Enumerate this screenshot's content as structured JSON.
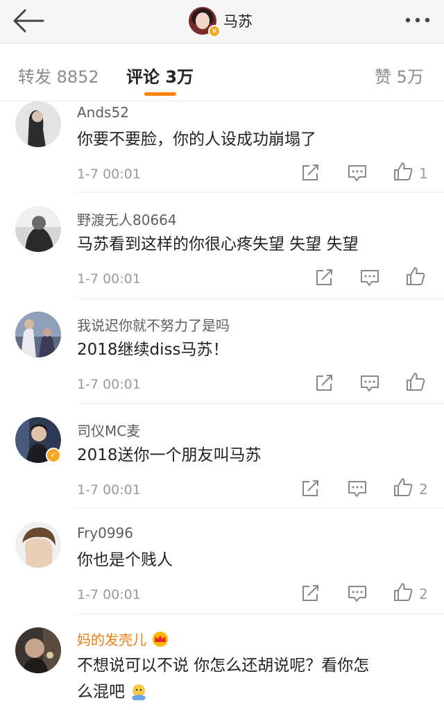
{
  "header": {
    "title": "马苏",
    "badge": "v",
    "back_icon": "back-arrow-icon",
    "more_icon": "more-dots-icon"
  },
  "tabs": {
    "repost": "转发 8852",
    "comment": "评论 3万",
    "like": "赞 5万"
  },
  "colors": {
    "accent": "#ff8200",
    "vip_name": "#f07b12",
    "badge": "#f5a623"
  },
  "comments": [
    {
      "name": "Ands52",
      "text": "你要不要脸，你的人设成功崩塌了",
      "time": "1-7 00:01",
      "likes": "1"
    },
    {
      "name": "野渡无人80664",
      "text": "马苏看到这样的你很心疼失望 失望 失望",
      "time": "1-7 00:01",
      "likes": ""
    },
    {
      "name": "我说迟你就不努力了是吗",
      "text": "2018继续diss马苏！",
      "time": "1-7 00:01",
      "likes": ""
    },
    {
      "name": "司仪MC麦",
      "text": "2018送你一个朋友叫马苏",
      "time": "1-7 00:01",
      "likes": "2"
    },
    {
      "name": "Fry0996",
      "text": "你也是个贱人",
      "time": "1-7 00:01",
      "likes": "2"
    },
    {
      "name": "妈的发壳儿",
      "text_line1": "不想说可以不说 你怎么还胡说呢？看你怎",
      "text_line2": "么混吧"
    }
  ]
}
